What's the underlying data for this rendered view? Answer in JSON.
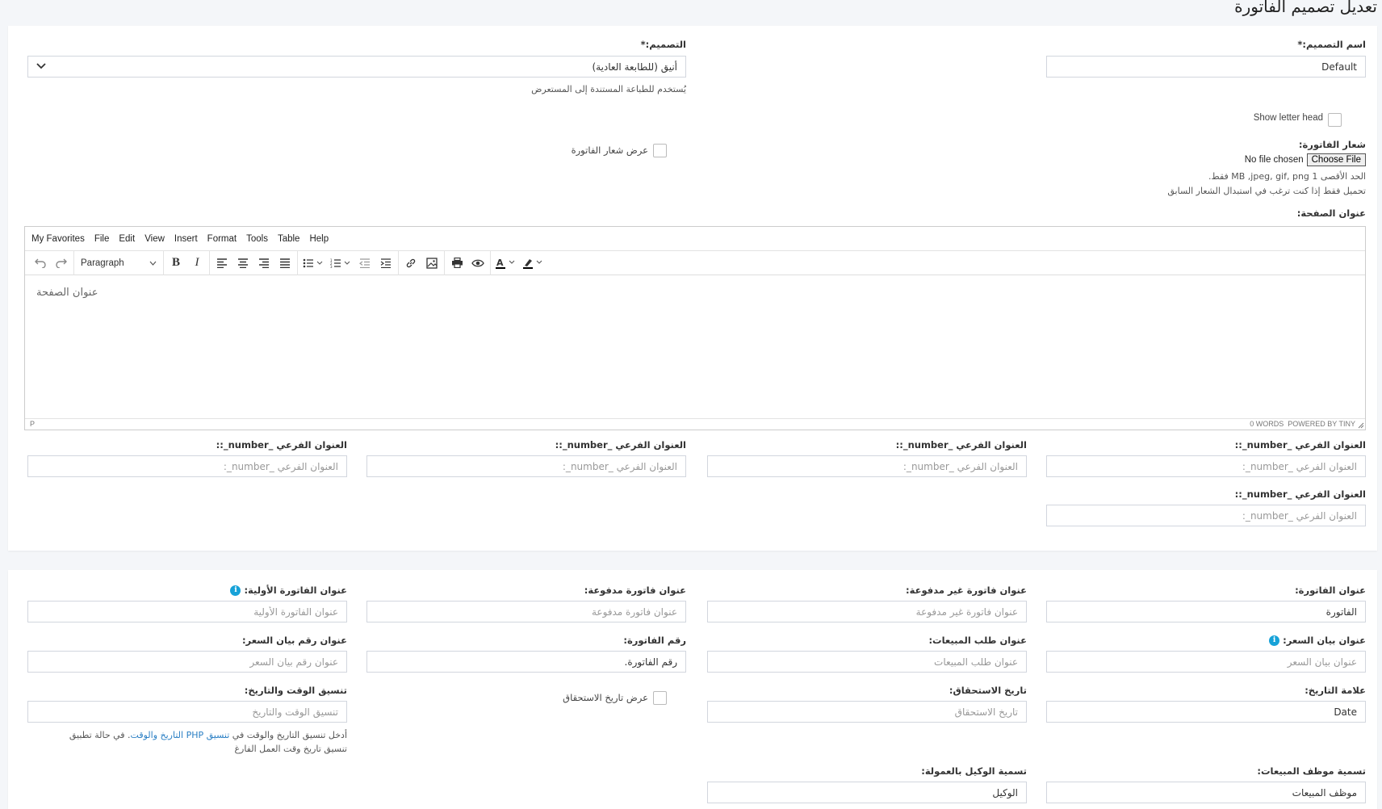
{
  "page_title": "تعديل تصميم الفاتورة",
  "section1": {
    "design_name_label": "اسم التصميم:*",
    "design_name_value": "Default",
    "design_label": "التصميم:*",
    "design_value": "أنيق (للطابعة العادية)",
    "design_help": "يُستخدم للطباعة المستندة إلى المستعرض",
    "show_letter_head": "Show letter head",
    "invoice_logo_label": "شعار الفاتورة:",
    "choose_file": "Choose File",
    "no_file": "No file chosen",
    "logo_help1": "الحد الأقصى 1 MB ,jpeg, gif, png فقط.",
    "logo_help2": "تحميل فقط إذا كنت ترغب في استبدال الشعار السابق",
    "show_invoice_logo": "عرض شعار الفاتورة",
    "header_text_label": "عنوان الصفحة:",
    "editor": {
      "menu": [
        "My Favorites",
        "File",
        "Edit",
        "View",
        "Insert",
        "Format",
        "Tools",
        "Table",
        "Help"
      ],
      "block_format": "Paragraph",
      "content": "عنوان الصفحة",
      "path": "P",
      "status": "0 WORDS  POWERED BY TINY"
    },
    "sub_heading_label": "العنوان الفرعي _number_::",
    "sub_heading_placeholder": "العنوان الفرعي _number_:"
  },
  "section2": {
    "invoice_heading_label": "عنوان الفاتورة:",
    "invoice_heading_value": "الفاتورة",
    "unpaid_label": "عنوان فاتورة غير مدفوعة:",
    "unpaid_placeholder": "عنوان فاتورة غير مدفوعة",
    "paid_label": "عنوان فاتورة مدفوعة:",
    "paid_placeholder": "عنوان فاتورة مدفوعة",
    "proforma_label": "عنوان الفاتورة الأولية:",
    "proforma_placeholder": "عنوان الفاتورة الأولية",
    "quotation_label": "عنوان بيان السعر:",
    "quotation_placeholder": "عنوان بيان السعر",
    "sales_order_label": "عنوان طلب المبيعات:",
    "sales_order_placeholder": "عنوان طلب المبيعات",
    "invoice_no_label": "رقم الفاتورة:",
    "invoice_no_value": "رقم الفاتورة.",
    "quotation_no_label": "عنوان رقم بيان السعر:",
    "quotation_no_placeholder": "عنوان رقم بيان السعر",
    "date_label": "علامة التاريخ:",
    "date_value": "Date",
    "due_date_label": "تاريخ الاستحقاق:",
    "due_date_placeholder": "تاريخ الاستحقاق",
    "show_due_date": "عرض تاريخ الاستحقاق",
    "datetime_label": "تنسيق الوقت والتاريخ:",
    "datetime_placeholder": "تنسيق الوقت والتاريخ",
    "datetime_help_a": "أدخل تنسيق التاريخ والوقت في",
    "datetime_help_link": "تنسيق PHP التاريخ والوقت",
    "datetime_help_b": ". في حالة تطبيق",
    "datetime_help_line2": "تنسيق تاريخ وقت العمل الفارغ",
    "sales_person_label": "تسمية موظف المبيعات:",
    "sales_person_value": "موظف المبيعات",
    "commission_agent_label": "تسمية الوكيل بالعمولة:",
    "commission_agent_value": "الوكيل"
  }
}
